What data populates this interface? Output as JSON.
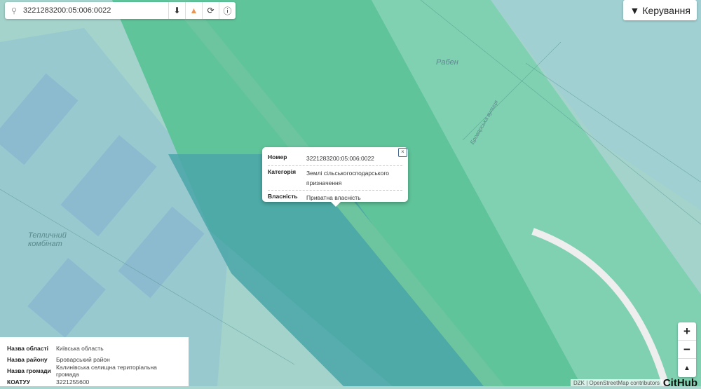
{
  "search": {
    "value": "3221283200:05:006:0022",
    "icons": [
      "search-icon",
      "download-icon",
      "warning-icon",
      "refresh-icon",
      "info-icon"
    ]
  },
  "control_button": {
    "label": "Керування",
    "icon": "filter-icon"
  },
  "popup": {
    "rows": [
      {
        "label": "Номер",
        "value": "3221283200:05:006:0022"
      },
      {
        "label": "Категорія",
        "value": "Землі сільськогосподарського призначення"
      },
      {
        "label": "Власність",
        "value": "Приватна власність"
      }
    ],
    "close": "×"
  },
  "info_panel": {
    "rows": [
      {
        "label": "Назва області",
        "value": "Київська область"
      },
      {
        "label": "Назва району",
        "value": "Броварський район"
      },
      {
        "label": "Назва громади",
        "value": "Калинівська селищна територіальна громада"
      },
      {
        "label": "КОАТУУ",
        "value": "3221255600"
      }
    ]
  },
  "map_labels": {
    "raben": "Рабен",
    "street": "Броварська вулиця",
    "greenhouse": "Тепличний комбінат"
  },
  "zoom": {
    "in": "+",
    "out": "−",
    "north": "▲"
  },
  "attribution": "DZK | OpenStreetMap contributors",
  "brand": "CitHub",
  "colors": {
    "band": "#5fc49a",
    "base": "#a9d6cf",
    "blue": "#8fbcd6",
    "parcel": "#4aa6a8"
  }
}
